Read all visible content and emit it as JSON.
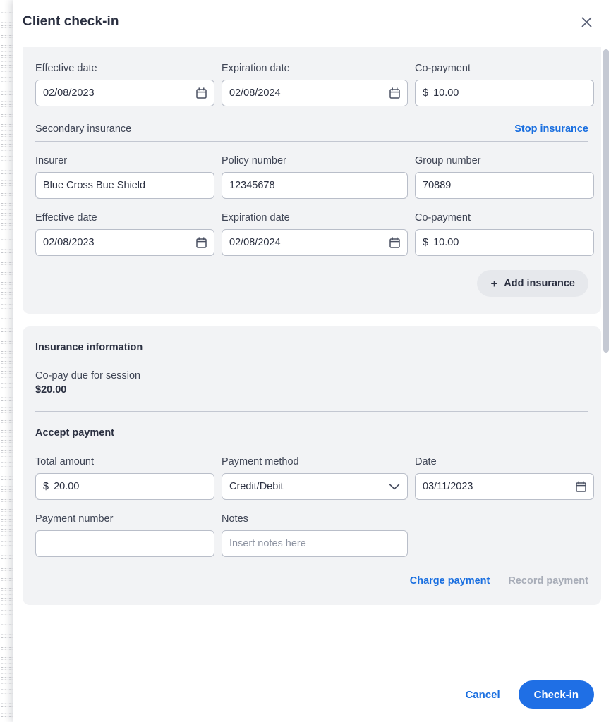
{
  "header": {
    "title": "Client check-in",
    "close_icon": "close-icon"
  },
  "insurance_card": {
    "primary_dates": {
      "effective_date": {
        "label": "Effective date",
        "value": "02/08/2023",
        "icon": "calendar-icon"
      },
      "expiration_date": {
        "label": "Expiration date",
        "value": "02/08/2024",
        "icon": "calendar-icon"
      },
      "copayment": {
        "label": "Co-payment",
        "currency": "$",
        "value": "10.00"
      }
    },
    "secondary": {
      "section_label": "Secondary insurance",
      "stop_link": "Stop insurance",
      "insurer": {
        "label": "Insurer",
        "value": "Blue Cross Bue Shield"
      },
      "policy_number": {
        "label": "Policy number",
        "value": "12345678"
      },
      "group_number": {
        "label": "Group number",
        "value": "70889"
      },
      "effective_date": {
        "label": "Effective date",
        "value": "02/08/2023",
        "icon": "calendar-icon"
      },
      "expiration_date": {
        "label": "Expiration date",
        "value": "02/08/2024",
        "icon": "calendar-icon"
      },
      "copayment": {
        "label": "Co-payment",
        "currency": "$",
        "value": "10.00"
      }
    },
    "add_insurance_button": {
      "label": "Add insurance",
      "icon": "plus-icon"
    }
  },
  "payment_card": {
    "title": "Insurance information",
    "copay_due_label": "Co-pay due for session",
    "copay_due_value": "$20.00",
    "accept_payment_title": "Accept payment",
    "total_amount": {
      "label": "Total amount",
      "currency": "$",
      "value": "20.00"
    },
    "payment_method": {
      "label": "Payment method",
      "value": "Credit/Debit",
      "icon": "chevron-down-icon"
    },
    "date": {
      "label": "Date",
      "value": "03/11/2023",
      "icon": "calendar-icon"
    },
    "payment_number": {
      "label": "Payment number",
      "value": ""
    },
    "notes": {
      "label": "Notes",
      "value": "",
      "placeholder": "Insert notes here"
    },
    "charge_payment_link": "Charge payment",
    "record_payment_link": "Record payment"
  },
  "footer": {
    "cancel_label": "Cancel",
    "checkin_label": "Check-in"
  },
  "colors": {
    "accent_blue": "#1f6fe5",
    "link_blue": "#1a6fe0",
    "muted_gray": "#a8adb8",
    "card_bg": "#f2f3f5"
  }
}
